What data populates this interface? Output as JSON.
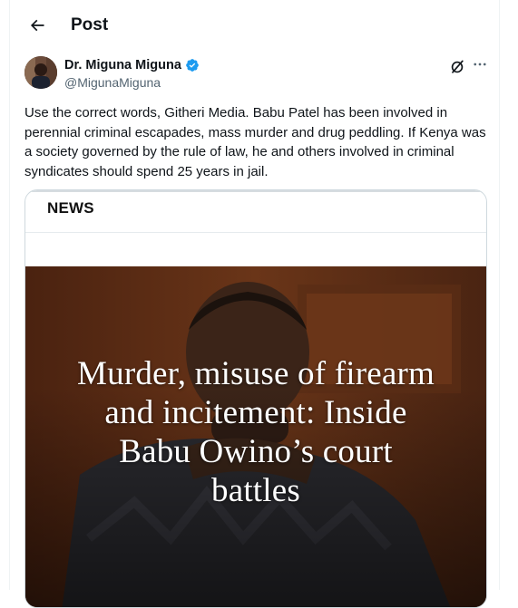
{
  "header": {
    "title": "Post"
  },
  "author": {
    "name": "Dr. Miguna Miguna",
    "handle": "@MigunaMiguna"
  },
  "tweet": {
    "text": "Use the correct words, Githeri Media. Babu Patel has been involved in perennial criminal escapades, mass murder and drug peddling. If Kenya was a society governed by the rule of law, he and others involved in criminal syndicates should spend 25 years in jail."
  },
  "card": {
    "label": "NEWS",
    "headline_lines": [
      "Murder, misuse of firearm",
      "and incitement: Inside",
      "Babu Owino’s court",
      "battles"
    ]
  },
  "icons": {
    "back": "arrow-left-icon",
    "verified": "verified-badge-icon",
    "grok": "grok-icon",
    "more": "more-horizontal-icon"
  },
  "colors": {
    "verified": "#1d9bf0",
    "text": "#0f1419",
    "secondary": "#536471"
  }
}
